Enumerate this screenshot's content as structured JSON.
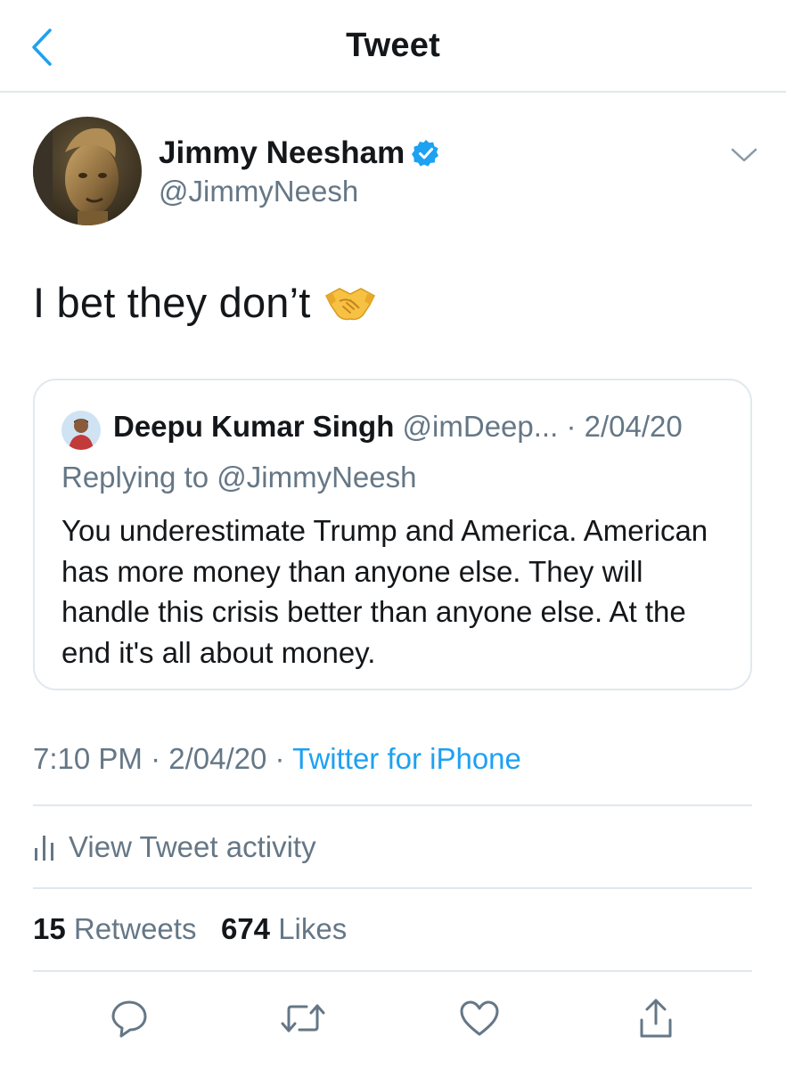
{
  "header": {
    "title": "Tweet",
    "back_icon": "chevron-left-icon",
    "accent": "#1da1f2"
  },
  "author": {
    "name": "Jimmy Neesham",
    "handle": "@JimmyNeesh",
    "verified": true,
    "verified_icon": "verified-badge-icon",
    "menu_icon": "chevron-down-icon"
  },
  "tweet": {
    "text": "I bet they don’t",
    "emoji_icon": "handshake-emoji-icon"
  },
  "quoted": {
    "name": "Deepu Kumar Singh",
    "handle": "@imDeep...",
    "separator": "·",
    "date": "2/04/20",
    "replying_to": "Replying to @JimmyNeesh",
    "text": "You underestimate Trump and America. American has more money than anyone else. They will handle this crisis better than anyone else. At the end it's all about money."
  },
  "meta": {
    "time": "7:10 PM",
    "separator": "·",
    "date": "2/04/20",
    "source": "Twitter for iPhone"
  },
  "activity": {
    "label": "View Tweet activity",
    "icon": "bar-chart-icon"
  },
  "stats": {
    "retweets_count": "15",
    "retweets_label": "Retweets",
    "likes_count": "674",
    "likes_label": "Likes"
  },
  "actions": {
    "reply_icon": "reply-bubble-icon",
    "retweet_icon": "retweet-icon",
    "like_icon": "heart-icon",
    "share_icon": "share-icon"
  },
  "colors": {
    "text": "#14171a",
    "secondary": "#657786",
    "link": "#1da1f2",
    "border": "#e1e8ed"
  }
}
